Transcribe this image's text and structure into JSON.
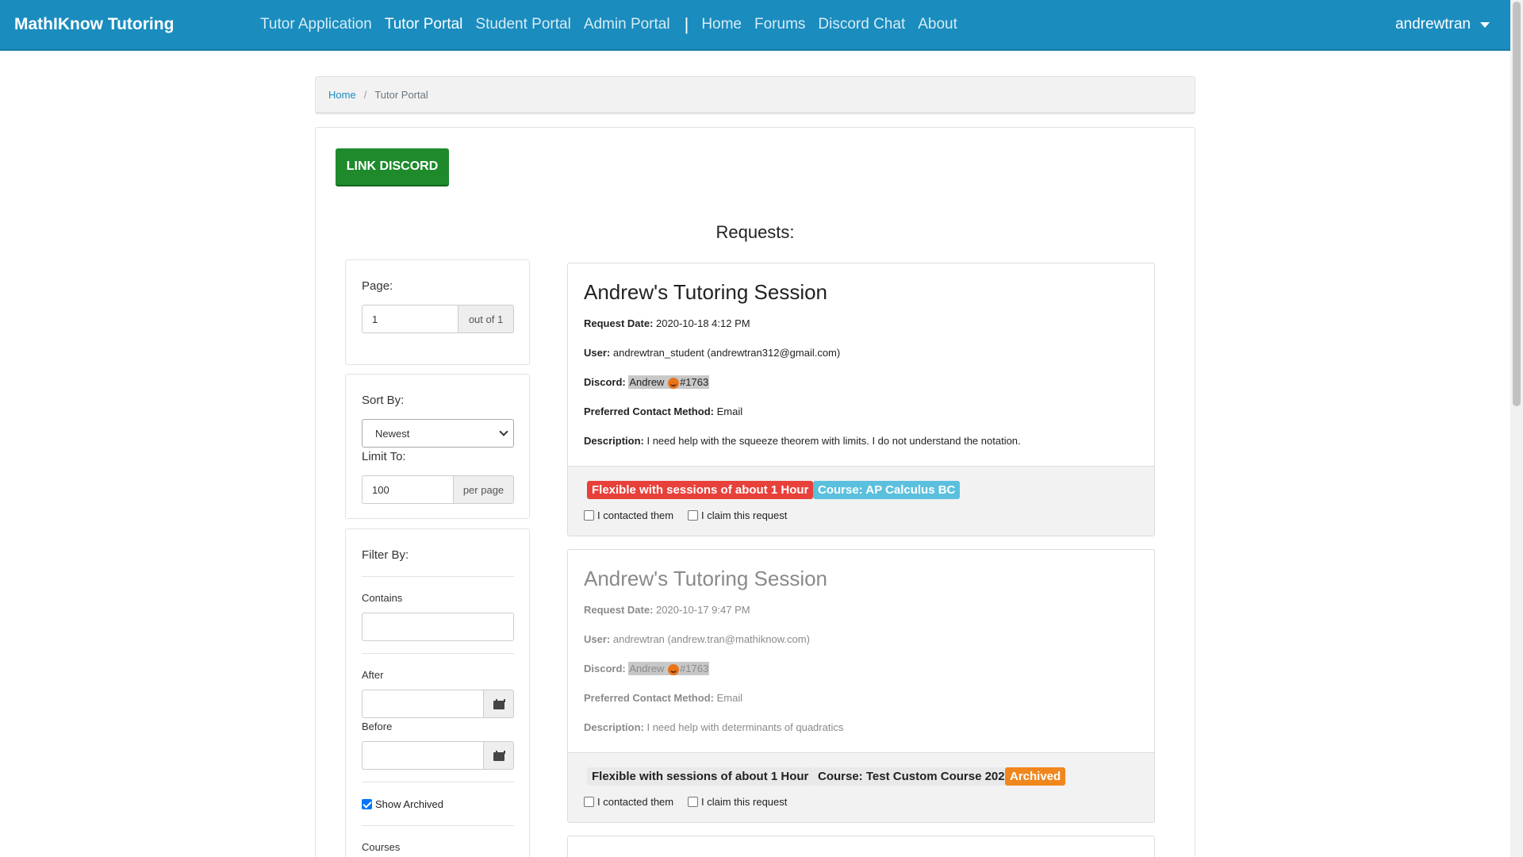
{
  "navbar": {
    "brand": "MathIKnow Tutoring",
    "links": [
      {
        "label": "Tutor Application",
        "active": false
      },
      {
        "label": "Tutor Portal",
        "active": true
      },
      {
        "label": "Student Portal",
        "active": false
      },
      {
        "label": "Admin Portal",
        "active": false
      }
    ],
    "separator": "|",
    "links2": [
      {
        "label": "Home"
      },
      {
        "label": "Forums"
      },
      {
        "label": "Discord Chat"
      },
      {
        "label": "About"
      }
    ],
    "user": "andrewtran",
    "user_icon": "caret-down-icon"
  },
  "breadcrumb": {
    "home": "Home",
    "separator": "/",
    "current": "Tutor Portal"
  },
  "link_discord_label": "LINK DISCORD",
  "requests_title": "Requests:",
  "pagination": {
    "label": "Page:",
    "value": "1",
    "addon": "out of 1"
  },
  "sort": {
    "label": "Sort By:",
    "value": "Newest",
    "limit_label": "Limit To:",
    "limit_value": "100",
    "limit_addon": "per page"
  },
  "filter": {
    "label": "Filter By:",
    "contains_label": "Contains",
    "after_label": "After",
    "before_label": "Before",
    "show_archived_label": "Show Archived",
    "show_archived_checked": true,
    "courses_label": "Courses",
    "calendar_icon": "calendar-icon"
  },
  "requests": [
    {
      "title": "Andrew's Tutoring Session",
      "date_label": "Request Date:",
      "date": "2020-10-18 4:12 PM",
      "user_label": "User:",
      "user": "andrewtran_student (andrewtran312@gmail.com)",
      "discord_label": "Discord:",
      "discord_name": "Andrew",
      "discord_icon": "pumpkin-emoji-icon",
      "discord_tag": "#1763",
      "contact_label": "Preferred Contact Method:",
      "contact": "Email",
      "desc_label": "Description:",
      "desc": "I need help with the squeeze theorem with limits. I do not understand the notation.",
      "badges": [
        "Flexible with sessions of about 1 Hour",
        "Course: AP Calculus BC"
      ],
      "contacted_label": "I contacted them",
      "claim_label": "I claim this request",
      "archived": false
    },
    {
      "title": "Andrew's Tutoring Session",
      "date_label": "Request Date:",
      "date": "2020-10-17 9:47 PM",
      "user_label": "User:",
      "user": "andrewtran (andrew.tran@mathiknow.com)",
      "discord_label": "Discord:",
      "discord_name": "Andrew",
      "discord_icon": "pumpkin-emoji-icon",
      "discord_tag": "#1763",
      "contact_label": "Preferred Contact Method:",
      "contact": "Email",
      "desc_label": "Description:",
      "desc": "I need help with determinants of quadratics",
      "badges": [
        "Flexible with sessions of about 1 Hour",
        "Course: Test Custom Course 202",
        "Archived"
      ],
      "contacted_label": "I contacted them",
      "claim_label": "I claim this request",
      "archived": true
    }
  ],
  "colors": {
    "navbar": "#1a8cbe",
    "discord_button": "#1e8a2c",
    "badge_duration": "#e8403a",
    "badge_course": "#5bc0de",
    "badge_archived": "#f0871e",
    "badge_muted": "#e9e9e9"
  }
}
